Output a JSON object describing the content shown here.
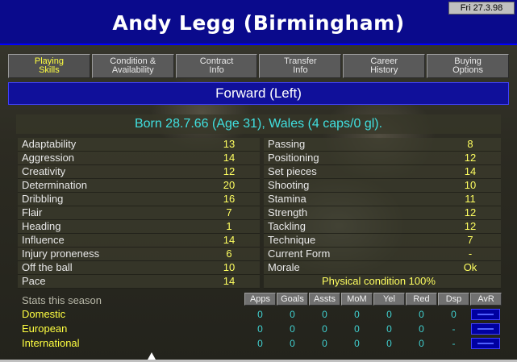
{
  "header": {
    "title": "Andy Legg (Birmingham)",
    "date": "Fri 27.3.98"
  },
  "tabs": [
    {
      "line1": "Playing",
      "line2": "Skills",
      "active": true
    },
    {
      "line1": "Condition &",
      "line2": "Availability",
      "active": false
    },
    {
      "line1": "Contract",
      "line2": "Info",
      "active": false
    },
    {
      "line1": "Transfer",
      "line2": "Info",
      "active": false
    },
    {
      "line1": "Career",
      "line2": "History",
      "active": false
    },
    {
      "line1": "Buying",
      "line2": "Options",
      "active": false
    }
  ],
  "position": "Forward (Left)",
  "bio": "Born 28.7.66 (Age 31), Wales (4 caps/0 gl).",
  "attributes_left": [
    {
      "name": "Adaptability",
      "value": "13"
    },
    {
      "name": "Aggression",
      "value": "14"
    },
    {
      "name": "Creativity",
      "value": "12"
    },
    {
      "name": "Determination",
      "value": "20"
    },
    {
      "name": "Dribbling",
      "value": "16"
    },
    {
      "name": "Flair",
      "value": "7"
    },
    {
      "name": "Heading",
      "value": "1"
    },
    {
      "name": "Influence",
      "value": "14"
    },
    {
      "name": "Injury proneness",
      "value": "6"
    },
    {
      "name": "Off the ball",
      "value": "10"
    },
    {
      "name": "Pace",
      "value": "14"
    }
  ],
  "attributes_right": [
    {
      "name": "Passing",
      "value": "8"
    },
    {
      "name": "Positioning",
      "value": "12"
    },
    {
      "name": "Set pieces",
      "value": "14"
    },
    {
      "name": "Shooting",
      "value": "10"
    },
    {
      "name": "Stamina",
      "value": "11"
    },
    {
      "name": "Strength",
      "value": "12"
    },
    {
      "name": "Tackling",
      "value": "12"
    },
    {
      "name": "Technique",
      "value": "7"
    },
    {
      "name": "Current Form",
      "value": "-"
    },
    {
      "name": "Morale",
      "value": "Ok"
    }
  ],
  "physical_condition": "Physical condition 100%",
  "stats": {
    "heading": "Stats this season",
    "columns": [
      "Apps",
      "Goals",
      "Assts",
      "MoM",
      "Yel",
      "Red",
      "Dsp",
      "AvR"
    ],
    "rows": [
      {
        "competition": "Domestic",
        "values": [
          "0",
          "0",
          "0",
          "0",
          "0",
          "0",
          "0"
        ]
      },
      {
        "competition": "European",
        "values": [
          "0",
          "0",
          "0",
          "0",
          "0",
          "0",
          "-"
        ]
      },
      {
        "competition": "International",
        "values": [
          "0",
          "0",
          "0",
          "0",
          "0",
          "0",
          "-"
        ]
      }
    ]
  },
  "colors": {
    "title_bar": "#0a0a8c",
    "active_tab_text": "#ffff40",
    "value_text": "#ffff60",
    "bio_text": "#40e0e0",
    "stat_values": "#40d0d0"
  }
}
